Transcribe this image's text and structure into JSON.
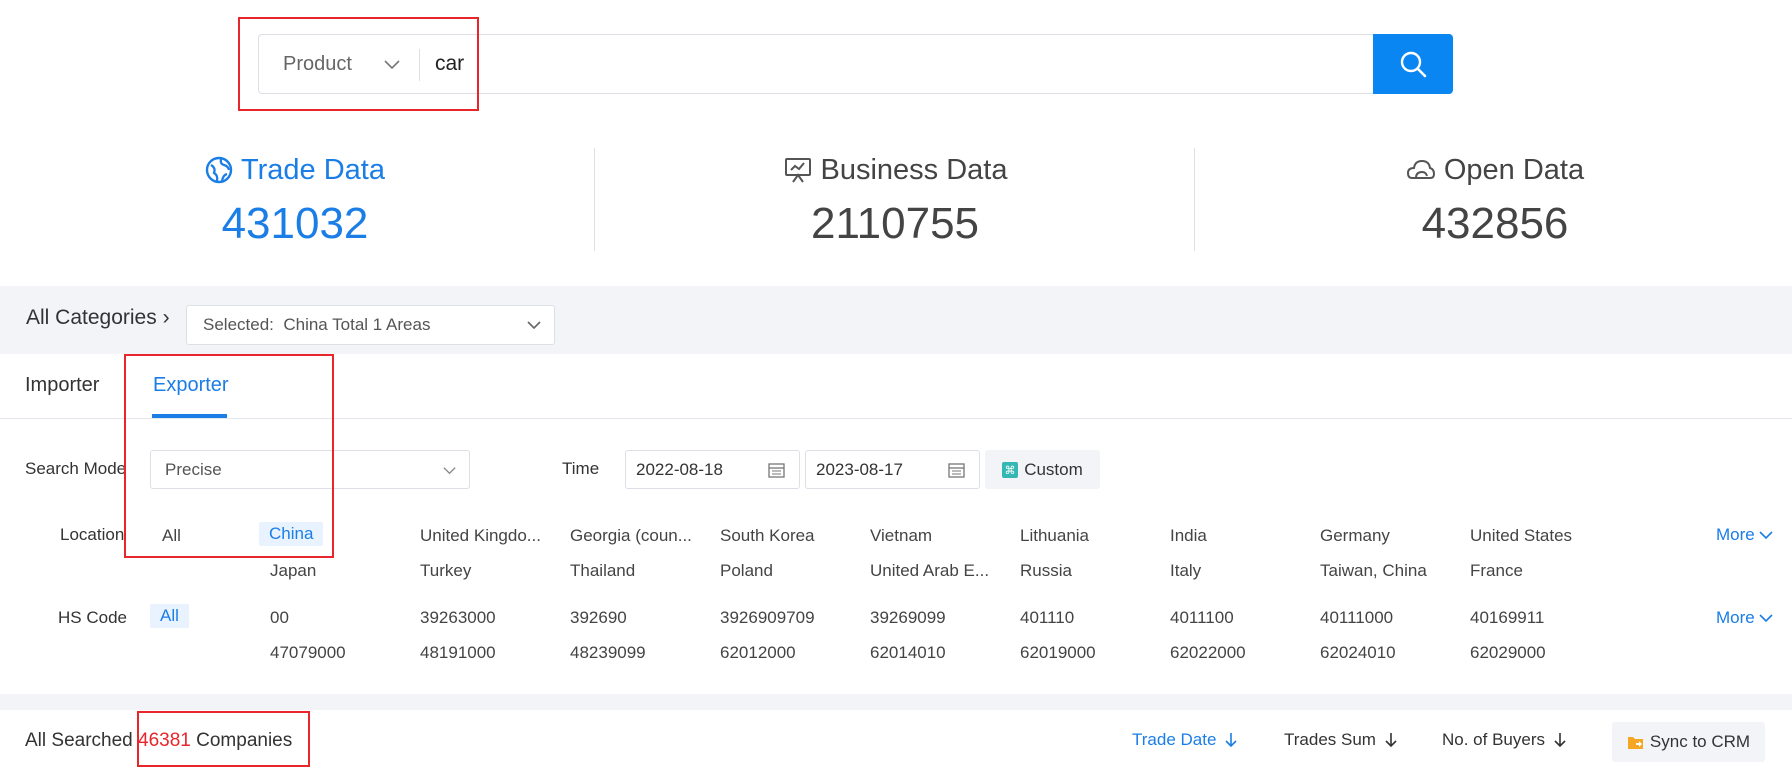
{
  "search": {
    "type_label": "Product",
    "query": "car"
  },
  "stats": [
    {
      "label": "Trade Data",
      "value": "431032"
    },
    {
      "label": "Business Data",
      "value": "2110755"
    },
    {
      "label": "Open Data",
      "value": "432856"
    }
  ],
  "categories": {
    "label": "All Categories",
    "selected_prefix": "Selected:",
    "selected_value": "China Total 1 Areas"
  },
  "tabs": [
    "Importer",
    "Exporter"
  ],
  "filters": {
    "search_mode_label": "Search Mode",
    "search_mode_value": "Precise",
    "time_label": "Time",
    "date_from": "2022-08-18",
    "date_to": "2023-08-17",
    "custom_label": "Custom",
    "location_label": "Location",
    "location_all": "All",
    "location_selected": "China",
    "locations_row1": [
      "United Kingdo...",
      "Georgia (coun...",
      "South Korea",
      "Vietnam",
      "Lithuania",
      "India",
      "Germany",
      "United States"
    ],
    "locations_row2": [
      "Japan",
      "Turkey",
      "Thailand",
      "Poland",
      "United Arab E...",
      "Russia",
      "Italy",
      "Taiwan, China",
      "France"
    ],
    "hs_label": "HS Code",
    "hs_all": "All",
    "hs_row1": [
      "00",
      "39263000",
      "392690",
      "3926909709",
      "39269099",
      "401110",
      "4011100",
      "40111000",
      "40169911"
    ],
    "hs_row2": [
      "47079000",
      "48191000",
      "48239099",
      "62012000",
      "62014010",
      "62019000",
      "62022000",
      "62024010",
      "62029000"
    ],
    "more_label": "More"
  },
  "results": {
    "prefix": "All Searched",
    "count": "46381",
    "suffix": "Companies",
    "sort_trade_date": "Trade Date",
    "sort_trades_sum": "Trades Sum",
    "sort_buyers": "No. of Buyers",
    "sync_label": "Sync to CRM"
  },
  "colors": {
    "accent": "#1a7ee6",
    "button": "#0a86f3",
    "highlight_red": "#e8262b"
  }
}
